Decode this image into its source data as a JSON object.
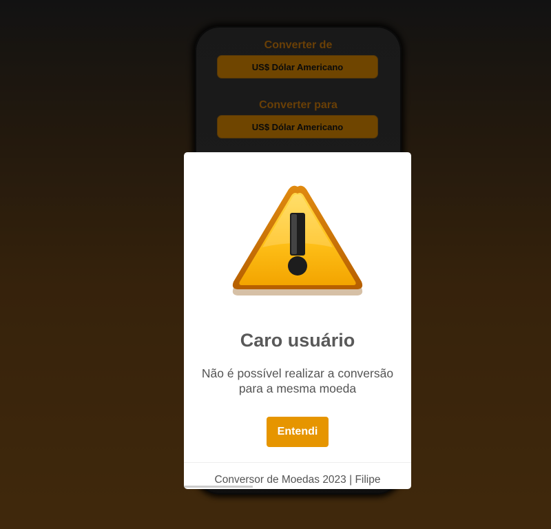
{
  "converter": {
    "from_label": "Converter de",
    "from_value": "US$ Dólar Americano",
    "to_label": "Converter para",
    "to_value": "US$ Dólar Americano"
  },
  "alert": {
    "icon": "warning-triangle-icon",
    "title": "Caro usuário",
    "message": "Não é possível realizar a conversão para a mesma moeda",
    "confirm_label": "Entendi",
    "footer": "Conversor de Moedas 2023 | Filipe"
  },
  "colors": {
    "accent": "#e69500",
    "select_bg": "#b97400",
    "label": "#b06a0a"
  }
}
